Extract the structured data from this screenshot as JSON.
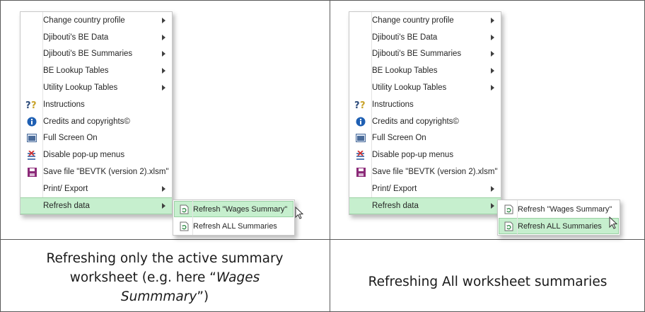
{
  "left_panel": {
    "menu_items": [
      {
        "label": "Change country profile",
        "icon": "",
        "has_submenu": true
      },
      {
        "label": "Djibouti's BE Data",
        "icon": "",
        "has_submenu": true
      },
      {
        "label": "Djibouti's BE Summaries",
        "icon": "",
        "has_submenu": true
      },
      {
        "label": "BE Lookup Tables",
        "icon": "",
        "has_submenu": true
      },
      {
        "label": "Utility Lookup Tables",
        "icon": "",
        "has_submenu": true
      },
      {
        "label": "Instructions",
        "icon": "help-icon",
        "has_submenu": false
      },
      {
        "label": "Credits and copyrights©",
        "icon": "info-icon",
        "has_submenu": false
      },
      {
        "label": "Full Screen On",
        "icon": "fullscreen-icon",
        "has_submenu": false
      },
      {
        "label": "Disable pop-up menus",
        "icon": "disable-menu-icon",
        "has_submenu": false
      },
      {
        "label": "Save file \"BEVTK (version 2).xlsm\"",
        "icon": "save-icon",
        "has_submenu": false
      },
      {
        "label": "Print/ Export",
        "icon": "",
        "has_submenu": true
      },
      {
        "label": "Refresh data",
        "icon": "",
        "has_submenu": true
      }
    ],
    "submenu_items": [
      {
        "label": "Refresh \"Wages Summary\"",
        "icon": "refresh-icon"
      },
      {
        "label": "Refresh ALL Summaries",
        "icon": "refresh-icon"
      }
    ],
    "caption_line1": "Refreshing only the active summary",
    "caption_line2_pre": "worksheet (e.g. here “",
    "caption_line2_em": "Wages",
    "caption_line3_em": "Summmary",
    "caption_line3_post": "”)"
  },
  "right_panel": {
    "menu_items": [
      {
        "label": "Change country profile",
        "icon": "",
        "has_submenu": true
      },
      {
        "label": "Djibouti's BE Data",
        "icon": "",
        "has_submenu": true
      },
      {
        "label": "Djibouti's BE Summaries",
        "icon": "",
        "has_submenu": true
      },
      {
        "label": "BE Lookup Tables",
        "icon": "",
        "has_submenu": true
      },
      {
        "label": "Utility Lookup Tables",
        "icon": "",
        "has_submenu": true
      },
      {
        "label": "Instructions",
        "icon": "help-icon",
        "has_submenu": false
      },
      {
        "label": "Credits and copyrights©",
        "icon": "info-icon",
        "has_submenu": false
      },
      {
        "label": "Full Screen On",
        "icon": "fullscreen-icon",
        "has_submenu": false
      },
      {
        "label": "Disable pop-up menus",
        "icon": "disable-menu-icon",
        "has_submenu": false
      },
      {
        "label": "Save file \"BEVTK (version 2).xlsm\"",
        "icon": "save-icon",
        "has_submenu": false
      },
      {
        "label": "Print/ Export",
        "icon": "",
        "has_submenu": true
      },
      {
        "label": "Refresh data",
        "icon": "",
        "has_submenu": true
      }
    ],
    "submenu_items": [
      {
        "label": "Refresh \"Wages Summary\"",
        "icon": "refresh-icon"
      },
      {
        "label": "Refresh ALL Summaries",
        "icon": "refresh-icon"
      }
    ],
    "caption": "Refreshing All worksheet summaries"
  },
  "colors": {
    "highlight_bg": "#c6efce",
    "highlight_border": "#9ad0a3",
    "table_border": "#5a5a5a"
  }
}
